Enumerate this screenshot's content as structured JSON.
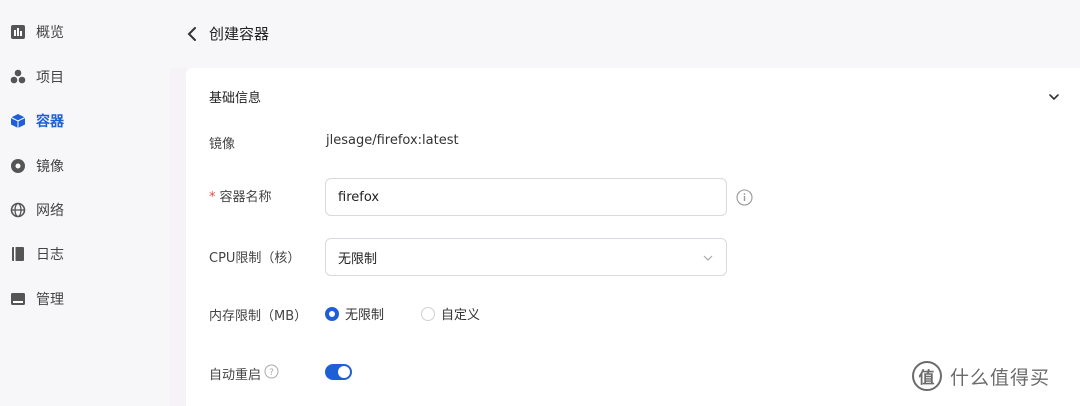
{
  "sidebar": {
    "items": [
      {
        "label": "概览",
        "icon": "bar-chart-icon"
      },
      {
        "label": "项目",
        "icon": "cubes-icon"
      },
      {
        "label": "容器",
        "icon": "cube-icon",
        "active": true
      },
      {
        "label": "镜像",
        "icon": "disc-icon"
      },
      {
        "label": "网络",
        "icon": "globe-icon"
      },
      {
        "label": "日志",
        "icon": "book-icon"
      },
      {
        "label": "管理",
        "icon": "panel-icon"
      }
    ]
  },
  "header": {
    "title": "创建容器"
  },
  "section": {
    "title": "基础信息"
  },
  "form": {
    "image_label": "镜像",
    "image_value": "jlesage/firefox:latest",
    "name_required": "*",
    "name_label": "容器名称",
    "name_value": "firefox",
    "cpu_label": "CPU限制（核）",
    "cpu_value": "无限制",
    "memory_label": "内存限制（MB）",
    "memory_options": [
      "无限制",
      "自定义"
    ],
    "memory_selected": "无限制",
    "autorestart_label": "自动重启",
    "autorestart_on": true
  },
  "colors": {
    "accent": "#1f5fd6",
    "required": "#e24b4b"
  },
  "watermark": {
    "text": "什么值得买",
    "logo_char": "值"
  }
}
